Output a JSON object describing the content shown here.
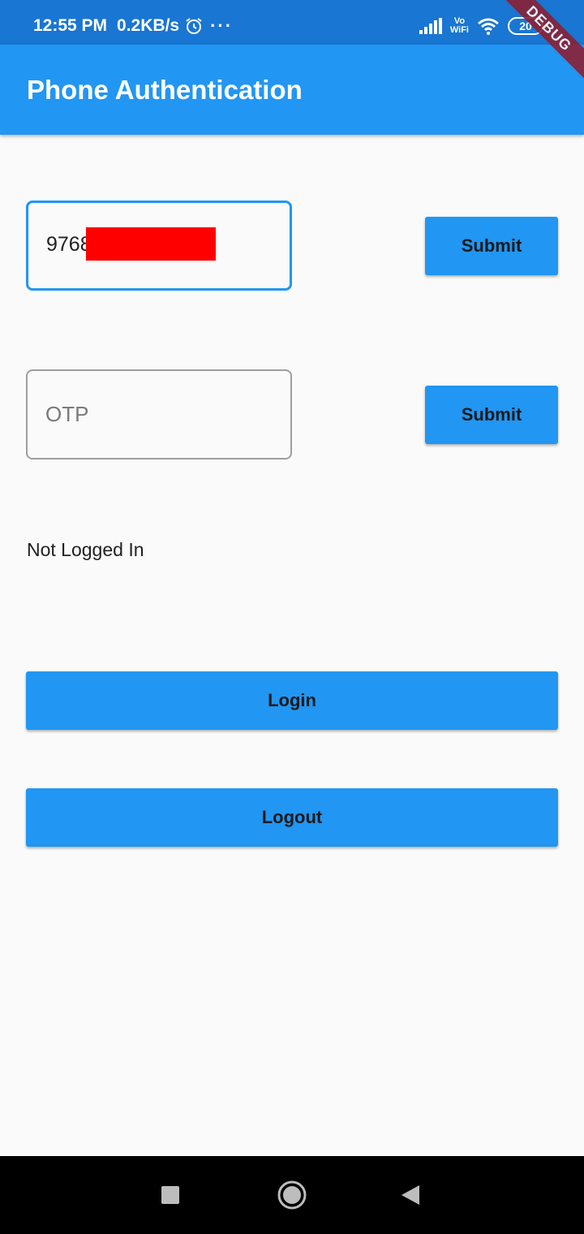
{
  "status_bar": {
    "time": "12:55 PM",
    "net_speed": "0.2KB/s",
    "more_indicator": "···",
    "vowifi_top": "Vo",
    "vowifi_bottom": "WiFi",
    "battery": "20"
  },
  "debug_banner": "DEBUG",
  "app_bar": {
    "title": "Phone Authentication"
  },
  "phone_field": {
    "value": "9768"
  },
  "phone_submit_label": "Submit",
  "otp_field": {
    "placeholder": "OTP",
    "value": ""
  },
  "otp_submit_label": "Submit",
  "auth_status": "Not Logged In",
  "login_label": "Login",
  "logout_label": "Logout",
  "colors": {
    "primary": "#2196f3",
    "status_bar": "#1976d2",
    "background": "#fafafa",
    "redaction": "#ff0000",
    "debug_ribbon": "#8b2035"
  },
  "icons": {
    "alarm": "alarm-clock-icon",
    "signal": "cell-signal-icon",
    "wifi": "wifi-icon",
    "battery": "battery-icon",
    "nav_recent": "square-recents-icon",
    "nav_home": "circle-home-icon",
    "nav_back": "triangle-back-icon"
  }
}
